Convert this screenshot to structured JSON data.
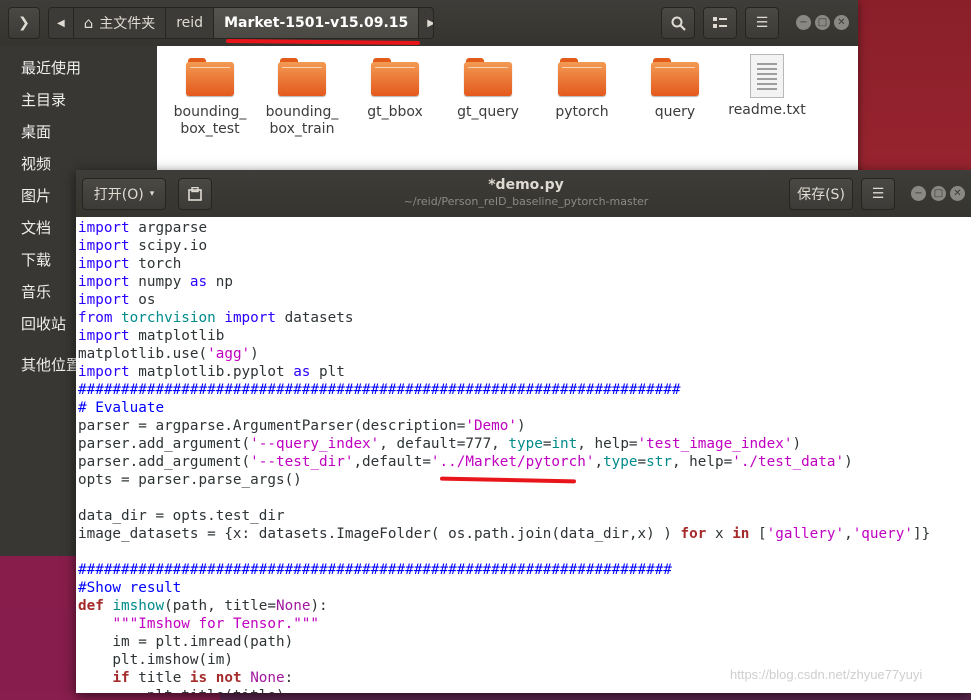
{
  "file_manager": {
    "path": {
      "home": "主文件夹",
      "crumbs": [
        "reid",
        "Market-1501-v15.09.15"
      ]
    },
    "sidebar": [
      "最近使用",
      "主目录",
      "桌面",
      "视频",
      "图片",
      "文档",
      "下载",
      "音乐",
      "回收站",
      "其他位置"
    ],
    "files": [
      {
        "name": "bounding_\nbox_test",
        "icon": "folder-icon"
      },
      {
        "name": "bounding_\nbox_train",
        "icon": "folder-icon"
      },
      {
        "name": "gt_bbox",
        "icon": "folder-icon"
      },
      {
        "name": "gt_query",
        "icon": "folder-icon"
      },
      {
        "name": "pytorch",
        "icon": "folder-icon"
      },
      {
        "name": "query",
        "icon": "folder-icon"
      },
      {
        "name": "readme.txt",
        "icon": "text-file-icon"
      }
    ]
  },
  "editor": {
    "open_label": "打开(O)",
    "title": "*demo.py",
    "subtitle": "~/reid/Person_reID_baseline_pytorch-master",
    "save_label": "保存(S)",
    "code_lines": [
      [
        [
          "kw2",
          "import"
        ],
        [
          "",
          "argparse"
        ]
      ],
      [
        [
          "kw2",
          "import"
        ],
        [
          "",
          "scipy.io"
        ]
      ],
      [
        [
          "kw2",
          "import"
        ],
        [
          "",
          "torch"
        ]
      ],
      [
        [
          "kw2",
          "import"
        ],
        [
          "",
          "numpy "
        ],
        [
          "kw2",
          "as"
        ],
        [
          "",
          " np"
        ]
      ],
      [
        [
          "kw2",
          "import"
        ],
        [
          "",
          "os"
        ]
      ],
      [
        [
          "kw2",
          "from"
        ],
        [
          "bi",
          "torchvision"
        ],
        [
          "kw2",
          "import"
        ],
        [
          "",
          "datasets"
        ]
      ],
      [
        [
          "kw2",
          "import"
        ],
        [
          "",
          "matplotlib"
        ]
      ],
      [
        [
          "",
          "matplotlib.use("
        ],
        [
          "str",
          "'agg'"
        ],
        [
          "",
          ")"
        ]
      ],
      [
        [
          "kw2",
          "import"
        ],
        [
          "",
          "matplotlib.pyplot "
        ],
        [
          "kw2",
          "as"
        ],
        [
          "",
          " plt"
        ]
      ],
      [
        [
          "cm",
          "######################################################################"
        ]
      ],
      [
        [
          "cm",
          "# Evaluate"
        ]
      ],
      [
        [
          "",
          "parser = argparse.ArgumentParser(description="
        ],
        [
          "str",
          "'Demo'"
        ],
        [
          "",
          ")"
        ]
      ],
      [
        [
          "",
          "parser.add_argument("
        ],
        [
          "str",
          "'--query_index'"
        ],
        [
          "",
          ", default=777, "
        ],
        [
          "bi",
          "type"
        ],
        [
          "",
          "="
        ],
        [
          "bi",
          "int"
        ],
        [
          "",
          ", help="
        ],
        [
          "str",
          "'test_image_index'"
        ],
        [
          "",
          ")"
        ]
      ],
      [
        [
          "",
          "parser.add_argument("
        ],
        [
          "str",
          "'--test_dir'"
        ],
        [
          "",
          ",default="
        ],
        [
          "str",
          "'../Market/pytorch'"
        ],
        [
          "",
          ","
        ],
        [
          "bi",
          "type"
        ],
        [
          "",
          "="
        ],
        [
          "bi",
          "str"
        ],
        [
          "",
          ", help="
        ],
        [
          "str",
          "'./test_data'"
        ],
        [
          "",
          ")"
        ]
      ],
      [
        [
          "",
          "opts = parser.parse_args()"
        ]
      ],
      [],
      [
        [
          "",
          "data_dir = opts.test_dir"
        ]
      ],
      [
        [
          "",
          "image_datasets = {x: datasets.ImageFolder( os.path.join(data_dir,x) ) "
        ],
        [
          "kw",
          "for"
        ],
        [
          "",
          " x "
        ],
        [
          "kw",
          "in"
        ],
        [
          "",
          " ["
        ],
        [
          "str",
          "'gallery'"
        ],
        [
          "",
          ","
        ],
        [
          "str",
          "'query'"
        ],
        [
          "",
          "]}"
        ]
      ],
      [],
      [
        [
          "cm",
          "#####################################################################"
        ]
      ],
      [
        [
          "cm",
          "#Show result"
        ]
      ],
      [
        [
          "kw",
          "def"
        ],
        [
          "",
          " "
        ],
        [
          "bi",
          "imshow"
        ],
        [
          "",
          "(path, title="
        ],
        [
          "const",
          "None"
        ],
        [
          "",
          "):"
        ]
      ],
      [
        [
          "",
          "    "
        ],
        [
          "str",
          "\"\"\"Imshow for Tensor.\"\"\""
        ]
      ],
      [
        [
          "",
          "    im = plt.imread(path)"
        ]
      ],
      [
        [
          "",
          "    plt.imshow(im)"
        ]
      ],
      [
        [
          "",
          "    "
        ],
        [
          "kw",
          "if"
        ],
        [
          "",
          " title "
        ],
        [
          "kw",
          "is not"
        ],
        [
          "",
          " "
        ],
        [
          "const",
          "None"
        ],
        [
          "",
          ":"
        ]
      ],
      [
        [
          "",
          "        plt.title(title)"
        ]
      ]
    ]
  },
  "watermark": "https://blog.csdn.net/zhyue77yuyi",
  "colors": {
    "annotation_red": "#e8161b",
    "folder_orange": "#e4591c",
    "titlebar": "#3c3b37"
  }
}
